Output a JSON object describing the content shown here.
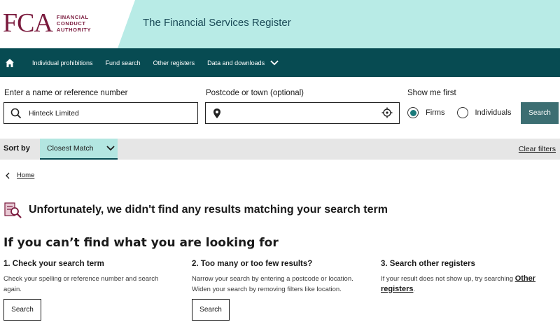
{
  "header": {
    "logo_mark": "FCA",
    "logo_text": [
      "FINANCIAL",
      "CONDUCT",
      "AUTHORITY"
    ],
    "site_title": "The Financial Services Register",
    "band_color": "#b8ebe6",
    "brand_color": "#7a1a3d"
  },
  "nav": {
    "bg_color": "#074b52",
    "home_icon": "home-icon",
    "items": [
      {
        "label": "Individual prohibitions"
      },
      {
        "label": "Fund search"
      },
      {
        "label": "Other registers"
      },
      {
        "label": "Data and downloads"
      }
    ]
  },
  "search": {
    "name_label": "Enter a name or reference number",
    "name_value": "Hinteck Limited",
    "postcode_label": "Postcode or town (optional)",
    "postcode_value": "",
    "show_first_label": "Show me first",
    "options": [
      {
        "label": "Firms",
        "selected": true
      },
      {
        "label": "Individuals",
        "selected": false
      }
    ],
    "button_label": "Search"
  },
  "sort": {
    "label": "Sort by",
    "selected": "Closest Match",
    "clear_label": "Clear filters"
  },
  "breadcrumb": {
    "home_label": "Home"
  },
  "results": {
    "no_results_message": "Unfortunately, we didn't find any results matching your search term",
    "help_title": "If you can’t find what you are looking for",
    "columns": [
      {
        "title": "1. Check your search term",
        "text": "Check your spelling or reference number and search again.",
        "button": "Search"
      },
      {
        "title": "2. Too many or too few results?",
        "text": "Narrow your search by entering a postcode or location. Widen your search by removing filters like location.",
        "button": "Search"
      },
      {
        "title": "3. Search other registers",
        "text": "If your result does not show up, try searching ",
        "link": "Other registers",
        "text_after": "."
      }
    ]
  }
}
